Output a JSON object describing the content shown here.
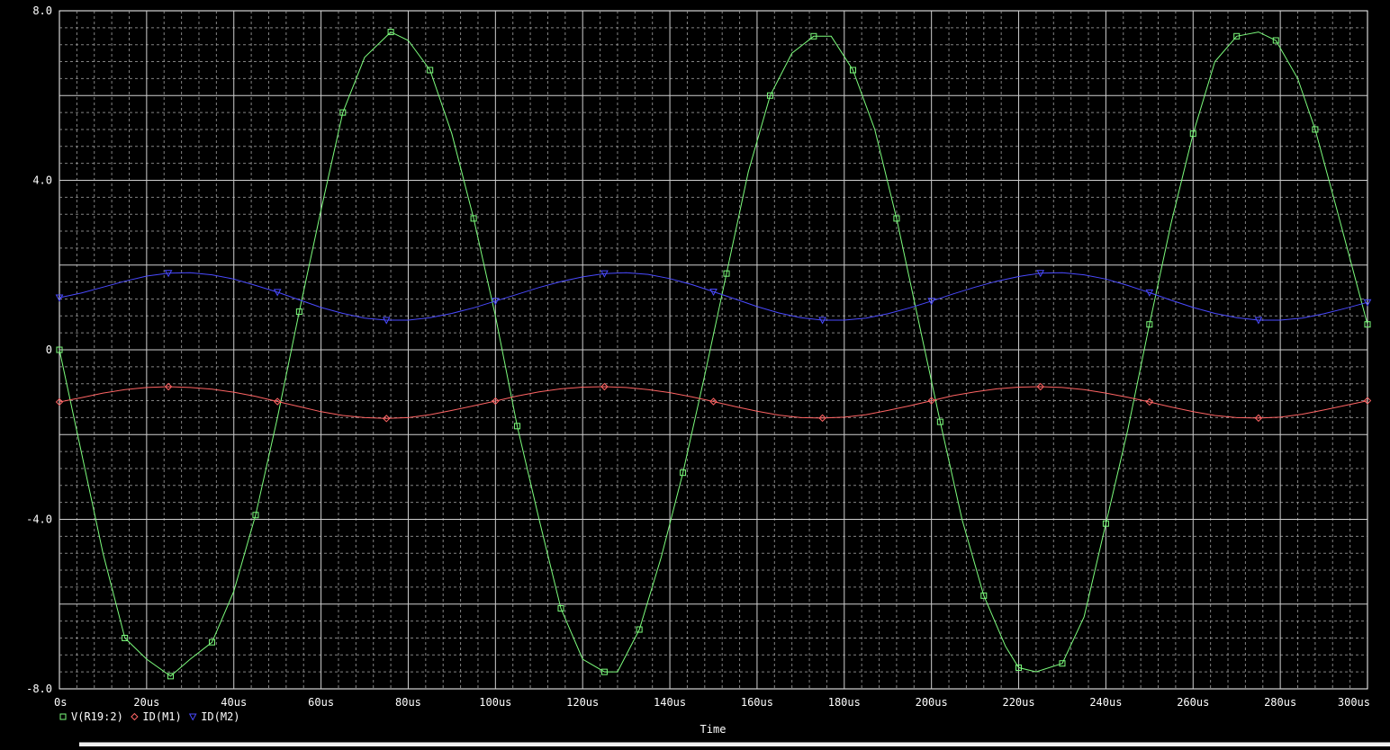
{
  "chart_data": {
    "type": "line",
    "xlabel": "Time",
    "x_ticks": [
      "0s",
      "20us",
      "40us",
      "60us",
      "80us",
      "100us",
      "120us",
      "140us",
      "160us",
      "180us",
      "200us",
      "220us",
      "240us",
      "260us",
      "280us",
      "300us"
    ],
    "y_ticks": [
      "8.0",
      "4.0",
      "0",
      "-4.0",
      "-8.0"
    ],
    "xlim_us": [
      0,
      300
    ],
    "ylim": [
      -8,
      8
    ],
    "grid": true,
    "legend_position": "bottom-left",
    "colors": {
      "background": "#000000",
      "grid": "#9a9a9a",
      "axis_text": "#ffffff"
    },
    "series": [
      {
        "name": "V(R19:2)",
        "color": "#7cfc7c",
        "marker": "square",
        "x_us": [
          0,
          10,
          15,
          20,
          25.5,
          30,
          35,
          40,
          45,
          50,
          55,
          60,
          65,
          70,
          76,
          80,
          85,
          90,
          95,
          100,
          105,
          110,
          115,
          120,
          125,
          128,
          133,
          138,
          143,
          148,
          153,
          158,
          163,
          168,
          173,
          177,
          182,
          187,
          192,
          197,
          202,
          207,
          212,
          217,
          220,
          224,
          230,
          235,
          240,
          245,
          250,
          255,
          260,
          265,
          270,
          275,
          279,
          284,
          288,
          293,
          300
        ],
        "y": [
          0,
          -4.8,
          -6.8,
          -7.3,
          -7.7,
          -7.3,
          -6.9,
          -5.7,
          -3.9,
          -1.6,
          0.9,
          3.3,
          5.6,
          6.9,
          7.5,
          7.3,
          6.6,
          5.1,
          3.1,
          0.8,
          -1.8,
          -4.0,
          -6.1,
          -7.3,
          -7.6,
          -7.6,
          -6.6,
          -4.9,
          -2.9,
          -0.6,
          1.8,
          4.2,
          6.0,
          7.0,
          7.4,
          7.4,
          6.6,
          5.2,
          3.1,
          0.7,
          -1.7,
          -4.0,
          -5.8,
          -7.0,
          -7.5,
          -7.6,
          -7.4,
          -6.3,
          -4.1,
          -1.9,
          0.6,
          3.0,
          5.1,
          6.8,
          7.4,
          7.5,
          7.3,
          6.4,
          5.2,
          3.3,
          0.6
        ]
      },
      {
        "name": "ID(M1)",
        "color": "#ff6464",
        "marker": "diamond",
        "x_us": [
          0,
          5,
          10,
          15,
          20,
          25,
          30,
          35,
          40,
          45,
          50,
          55,
          60,
          65,
          70,
          75,
          80,
          85,
          90,
          95,
          100,
          105,
          110,
          115,
          120,
          125,
          130,
          135,
          140,
          145,
          150,
          155,
          160,
          165,
          170,
          175,
          180,
          185,
          190,
          195,
          200,
          205,
          210,
          215,
          220,
          225,
          230,
          235,
          240,
          245,
          250,
          255,
          260,
          265,
          270,
          275,
          280,
          285,
          290,
          295,
          300
        ],
        "y": [
          -1.23,
          -1.13,
          -1.02,
          -0.94,
          -0.89,
          -0.87,
          -0.89,
          -0.93,
          -1.0,
          -1.1,
          -1.22,
          -1.34,
          -1.46,
          -1.55,
          -1.6,
          -1.62,
          -1.6,
          -1.53,
          -1.43,
          -1.32,
          -1.21,
          -1.09,
          -0.99,
          -0.92,
          -0.88,
          -0.87,
          -0.89,
          -0.94,
          -1.01,
          -1.11,
          -1.22,
          -1.34,
          -1.45,
          -1.54,
          -1.6,
          -1.61,
          -1.59,
          -1.53,
          -1.43,
          -1.32,
          -1.2,
          -1.08,
          -0.99,
          -0.92,
          -0.88,
          -0.87,
          -0.89,
          -0.94,
          -1.02,
          -1.12,
          -1.23,
          -1.35,
          -1.46,
          -1.55,
          -1.6,
          -1.61,
          -1.59,
          -1.52,
          -1.42,
          -1.31,
          -1.2
        ]
      },
      {
        "name": "ID(M2)",
        "color": "#4a4aff",
        "marker": "triangle-down",
        "x_us": [
          0,
          5,
          10,
          15,
          20,
          25,
          30,
          35,
          40,
          45,
          50,
          55,
          60,
          65,
          70,
          75,
          80,
          85,
          90,
          95,
          100,
          105,
          110,
          115,
          120,
          125,
          130,
          135,
          140,
          145,
          150,
          155,
          160,
          165,
          170,
          175,
          180,
          185,
          190,
          195,
          200,
          205,
          210,
          215,
          220,
          225,
          230,
          235,
          240,
          245,
          250,
          255,
          260,
          265,
          270,
          275,
          280,
          285,
          290,
          295,
          300
        ],
        "y": [
          1.23,
          1.34,
          1.48,
          1.62,
          1.74,
          1.81,
          1.82,
          1.77,
          1.67,
          1.52,
          1.36,
          1.18,
          1.0,
          0.86,
          0.75,
          0.7,
          0.7,
          0.76,
          0.86,
          0.99,
          1.15,
          1.31,
          1.47,
          1.61,
          1.72,
          1.8,
          1.82,
          1.78,
          1.68,
          1.54,
          1.37,
          1.2,
          1.02,
          0.87,
          0.76,
          0.7,
          0.7,
          0.75,
          0.85,
          0.99,
          1.15,
          1.32,
          1.48,
          1.62,
          1.73,
          1.81,
          1.82,
          1.77,
          1.67,
          1.52,
          1.35,
          1.17,
          1.0,
          0.86,
          0.76,
          0.7,
          0.7,
          0.75,
          0.85,
          0.98,
          1.12
        ]
      }
    ],
    "legend": [
      {
        "label": "V(R19:2)",
        "color": "#7cfc7c",
        "marker": "square"
      },
      {
        "label": "ID(M1)",
        "color": "#ff6464",
        "marker": "diamond"
      },
      {
        "label": "ID(M2)",
        "color": "#4a4aff",
        "marker": "triangle-down"
      }
    ]
  }
}
